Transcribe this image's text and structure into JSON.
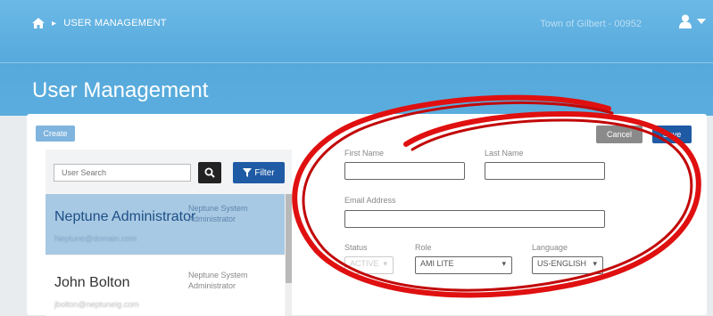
{
  "header": {
    "breadcrumb": "USER MANAGEMENT",
    "tenant": "Town of Gilbert - 00952",
    "page_title": "User Management"
  },
  "toolbar": {
    "create_label": "Create",
    "cancel_label": "Cancel",
    "save_label": "Save"
  },
  "list": {
    "search_placeholder": "User Search",
    "filter_label": "Filter",
    "users": [
      {
        "name": "Neptune Administrator",
        "role": "Neptune System Administrator",
        "email": "Neptune@domain.com"
      },
      {
        "name": "John Bolton",
        "role": "Neptune System Administrator",
        "email": "jbolton@neptuneig.com"
      }
    ]
  },
  "form": {
    "first_name_label": "First Name",
    "last_name_label": "Last Name",
    "email_label": "Email Address",
    "status_label": "Status",
    "status_value": "ACTIVE",
    "role_label": "Role",
    "role_value": "AMI LITE",
    "language_label": "Language",
    "language_value": "US-ENGLISH"
  },
  "colors": {
    "header_blue": "#5aaddd",
    "primary": "#1f5ba5",
    "selected_row": "#a8c9e3",
    "annotation_red": "#e01010"
  },
  "icons": [
    "home-icon",
    "user-icon",
    "chevron-down-icon",
    "search-icon",
    "filter-icon",
    "caret-down-icon"
  ]
}
